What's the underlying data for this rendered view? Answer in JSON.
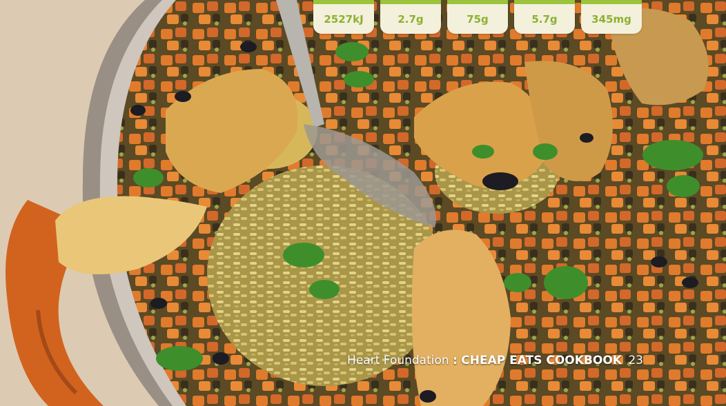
{
  "nutrition_tabs": [
    {
      "value": "2527kJ"
    },
    {
      "value": "2.7g"
    },
    {
      "value": "75g"
    },
    {
      "value": "5.7g"
    },
    {
      "value": "345mg"
    }
  ],
  "footer": {
    "brand": "Heart Foundation",
    "separator": ":",
    "book_title": "CHEAP EATS COOKBOOK",
    "page_number": "23"
  },
  "colors": {
    "tab_accent": "#9bc43c",
    "tab_text": "#8db030",
    "tab_bg": "#f3f0dc"
  }
}
